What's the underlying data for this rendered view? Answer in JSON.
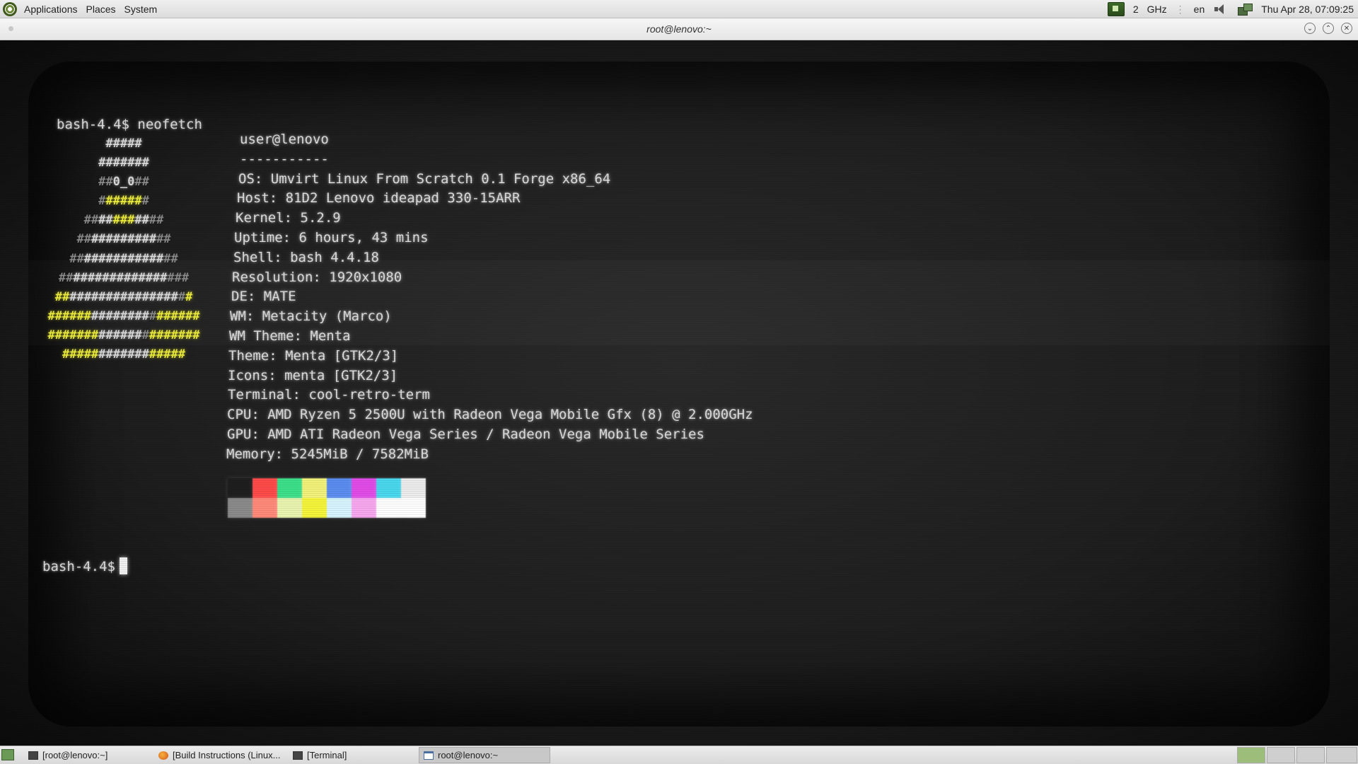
{
  "top_panel": {
    "menus": [
      "Applications",
      "Places",
      "System"
    ],
    "cpu_count": "2",
    "cpu_unit": "GHz",
    "keyboard_layout": "en",
    "clock": "Thu Apr 28, 07:09:25"
  },
  "window": {
    "title": "root@lenovo:~"
  },
  "terminal": {
    "command_line": "bash-4.4$ neofetch",
    "user_host": "user@lenovo",
    "separator": "-----------",
    "info": [
      {
        "key": "OS",
        "value": "Umvirt Linux From Scratch 0.1 Forge x86_64"
      },
      {
        "key": "Host",
        "value": "81D2 Lenovo ideapad 330-15ARR"
      },
      {
        "key": "Kernel",
        "value": "5.2.9"
      },
      {
        "key": "Uptime",
        "value": "6 hours, 43 mins"
      },
      {
        "key": "Shell",
        "value": "bash 4.4.18"
      },
      {
        "key": "Resolution",
        "value": "1920x1080"
      },
      {
        "key": "DE",
        "value": "MATE"
      },
      {
        "key": "WM",
        "value": "Metacity (Marco)"
      },
      {
        "key": "WM Theme",
        "value": "Menta"
      },
      {
        "key": "Theme",
        "value": "Menta [GTK2/3]"
      },
      {
        "key": "Icons",
        "value": "menta [GTK2/3]"
      },
      {
        "key": "Terminal",
        "value": "cool-retro-term"
      },
      {
        "key": "CPU",
        "value": "AMD Ryzen 5 2500U with Radeon Vega Mobile Gfx (8) @ 2.000GHz"
      },
      {
        "key": "GPU",
        "value": "AMD ATI Radeon Vega Series / Radeon Vega Mobile Series"
      },
      {
        "key": "Memory",
        "value": "5245MiB / 7582MiB"
      }
    ],
    "color_blocks": {
      "row1": [
        "#1e1e1e",
        "#ff4a4a",
        "#3de08a",
        "#f2f27a",
        "#5b8cf0",
        "#e14ce8",
        "#4ad8ee",
        "#ececec"
      ],
      "row2": [
        "#8a8a8a",
        "#ff8a7a",
        "#e8f4b0",
        "#f4f43a",
        "#d8f4ff",
        "#f7a8ef",
        "#ffffff",
        "#ffffff"
      ]
    },
    "prompt": "bash-4.4$"
  },
  "taskbar": {
    "tasks": [
      {
        "label": "[root@lenovo:~]",
        "icon": "terminal-icon"
      },
      {
        "label": "[Build Instructions (Linux...",
        "icon": "firefox-icon"
      },
      {
        "label": "[Terminal]",
        "icon": "terminal-icon"
      },
      {
        "label": "root@lenovo:~",
        "icon": "window-icon"
      }
    ]
  }
}
